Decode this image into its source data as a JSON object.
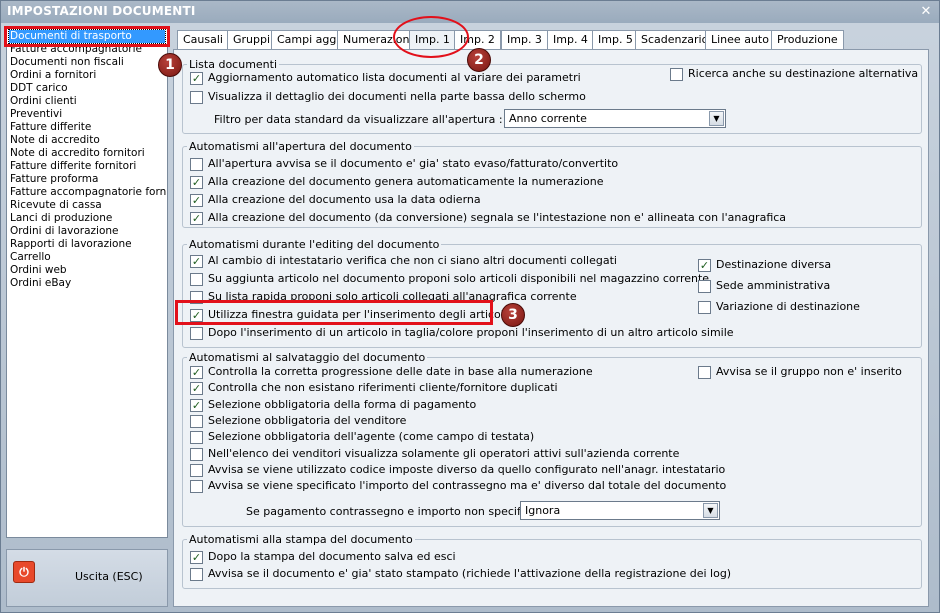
{
  "window": {
    "title": "IMPOSTAZIONI DOCUMENTI",
    "close_glyph": "✕"
  },
  "sidebar": {
    "items": [
      "Documenti di trasporto",
      "Fatture accompagnatorie",
      "Documenti non fiscali",
      "Ordini a fornitori",
      "DDT carico",
      "Ordini clienti",
      "Preventivi",
      "Fatture differite",
      "Note di accredito",
      "Note di accredito fornitori",
      "Fatture differite fornitori",
      "Fatture proforma",
      "Fatture accompagnatorie fornito",
      "Ricevute di cassa",
      "Lanci di produzione",
      "Ordini di lavorazione",
      "Rapporti di lavorazione",
      "Carrello",
      "Ordini web",
      "Ordini eBay"
    ],
    "selected_index": 0,
    "exit_label": "Uscita (ESC)",
    "exit_icon": "power-icon"
  },
  "tabs": [
    "Causali",
    "Gruppi",
    "Campi agg.",
    "Numerazioni",
    "Imp. 1",
    "Imp. 2",
    "Imp. 3",
    "Imp. 4",
    "Imp. 5",
    "Scadenzario",
    "Linee auto",
    "Produzione"
  ],
  "active_tab": "Imp. 1",
  "groups": {
    "lista": {
      "legend": "Lista documenti",
      "chk_aggiornamento": {
        "label": "Aggiornamento automatico lista documenti al variare dei parametri",
        "checked": true
      },
      "chk_ricerca": {
        "label": "Ricerca anche su destinazione alternativa",
        "checked": false
      },
      "chk_dettaglio": {
        "label": "Visualizza il dettaglio dei documenti nella parte bassa dello schermo",
        "checked": false
      },
      "filter_label": "Filtro per data standard da visualizzare all'apertura :",
      "filter_value": "Anno corrente"
    },
    "apertura": {
      "legend": "Automatismi all'apertura del documento",
      "items": [
        {
          "label": "All'apertura avvisa se il documento e' gia' stato evaso/fatturato/convertito",
          "checked": false
        },
        {
          "label": "Alla creazione del documento genera automaticamente la numerazione",
          "checked": true
        },
        {
          "label": "Alla creazione del documento usa la data odierna",
          "checked": true
        },
        {
          "label": "Alla creazione del documento (da conversione) segnala se l'intestazione non e' allineata con l'anagrafica",
          "checked": true
        }
      ]
    },
    "editing": {
      "legend": "Automatismi durante l'editing del documento",
      "items": [
        {
          "label": "Al cambio di intestatario verifica che non ci siano altri documenti collegati",
          "checked": true
        },
        {
          "label": "Su aggiunta articolo nel documento proponi solo articoli disponibili nel magazzino corrente",
          "checked": false
        },
        {
          "label": "Su lista rapida proponi solo articoli collegati all'anagrafica corrente",
          "checked": false
        },
        {
          "label": "Utilizza finestra guidata per l'inserimento degli articoli",
          "checked": true
        },
        {
          "label": "Dopo l'inserimento di un articolo in taglia/colore proponi l'inserimento di un altro articolo simile",
          "checked": false
        }
      ],
      "right": [
        {
          "label": "Destinazione diversa",
          "checked": true
        },
        {
          "label": "Sede amministrativa",
          "checked": false
        },
        {
          "label": "Variazione di destinazione",
          "checked": false
        }
      ]
    },
    "salvataggio": {
      "legend": "Automatismi al salvataggio del documento",
      "items": [
        {
          "label": "Controlla la corretta progressione delle date in base alla numerazione",
          "checked": true
        },
        {
          "label": "Controlla che non esistano riferimenti cliente/fornitore duplicati",
          "checked": true
        },
        {
          "label": "Selezione obbligatoria della forma di pagamento",
          "checked": true
        },
        {
          "label": "Selezione obbligatoria del venditore",
          "checked": false
        },
        {
          "label": "Selezione obbligatoria dell'agente (come campo di testata)",
          "checked": false
        },
        {
          "label": "Nell'elenco dei venditori visualizza solamente gli operatori attivi sull'azienda corrente",
          "checked": false
        },
        {
          "label": "Avvisa se viene utilizzato codice imposte diverso da quello configurato nell'anagr. intestatario",
          "checked": false
        },
        {
          "label": "Avvisa se viene specificato l'importo del contrassegno ma e' diverso dal totale del documento",
          "checked": false
        }
      ],
      "right": {
        "label": "Avvisa se il gruppo non e' inserito",
        "checked": false
      },
      "pay_label": "Se pagamento contrassegno e importo non specificato :",
      "pay_value": "Ignora"
    },
    "stampa": {
      "legend": "Automatismi alla stampa del documento",
      "items": [
        {
          "label": "Dopo la stampa del documento salva ed esci",
          "checked": true
        },
        {
          "label": "Avvisa se il documento e' gia' stato stampato (richiede l'attivazione della registrazione dei log)",
          "checked": false
        }
      ]
    }
  },
  "annotations": {
    "badge1": "1",
    "badge2": "2",
    "badge3": "3",
    "color": "#e2101a"
  },
  "glyphs": {
    "check": "✓",
    "dropdown": "▼",
    "power": "⏻"
  }
}
